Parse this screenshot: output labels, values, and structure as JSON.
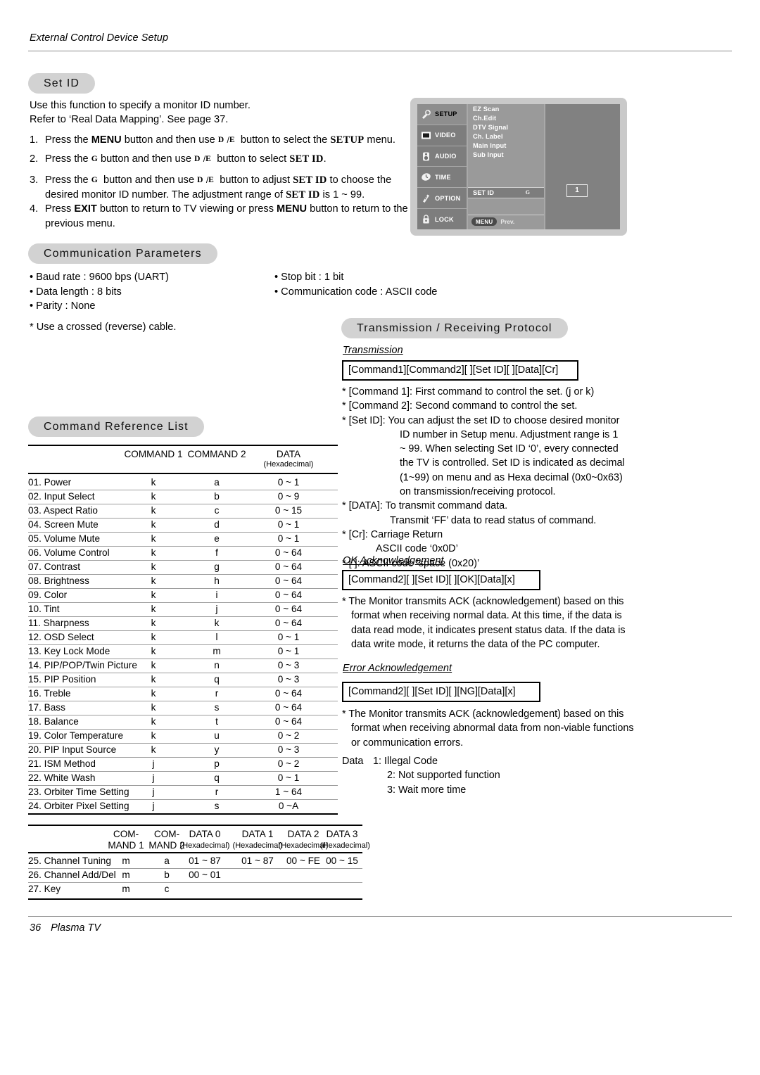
{
  "header": {
    "running_head": "External Control Device Setup"
  },
  "footer": {
    "page_number": "36",
    "product": "Plasma TV"
  },
  "set_id": {
    "title": "Set ID",
    "intro_line1": "Use this function to specify a monitor ID number.",
    "intro_line2": "Refer to ‘Real Data Mapping’. See page 37.",
    "steps": [
      {
        "num": "1.",
        "parts": [
          "Press the ",
          "MENU",
          " button and then use ",
          "D",
          "/",
          "E",
          " button to select the ",
          "SETUP",
          " menu."
        ]
      },
      {
        "num": "2.",
        "parts": [
          "Press the ",
          "G",
          " button and then use ",
          "D",
          "/",
          "E",
          " button to select ",
          "SET ID",
          "."
        ]
      },
      {
        "num": "3.",
        "parts": [
          "Press the ",
          "G",
          " button and then use ",
          "D",
          "/",
          "E",
          " button to adjust ",
          "SET ID",
          " to choose the desired monitor ID number. The adjustment range of ",
          "SET ID",
          " is 1 ~ 99."
        ]
      },
      {
        "num": "4.",
        "parts": [
          "Press ",
          "EXIT",
          " button to return to TV viewing or press ",
          "MENU",
          " button to return to the previous menu."
        ]
      }
    ]
  },
  "osd": {
    "categories": [
      {
        "label": "SETUP",
        "icon": "satellite-icon",
        "selected": true
      },
      {
        "label": "VIDEO",
        "icon": "screen-icon",
        "selected": false
      },
      {
        "label": "AUDIO",
        "icon": "speaker-icon",
        "selected": false
      },
      {
        "label": "TIME",
        "icon": "clock-icon",
        "selected": false
      },
      {
        "label": "OPTION",
        "icon": "remote-icon",
        "selected": false
      },
      {
        "label": "LOCK",
        "icon": "padlock-icon",
        "selected": false
      }
    ],
    "menu_items": [
      "EZ Scan",
      "Ch.Edit",
      "DTV Signal",
      "Ch. Label",
      "Main Input",
      "Sub Input"
    ],
    "highlighted_item": "SET ID",
    "highlighted_arrow": "G",
    "value": "1",
    "menu_button": "MENU",
    "prev_label": "Prev."
  },
  "communication": {
    "title": "Communication Parameters",
    "left": [
      "• Baud rate : 9600 bps (UART)",
      "• Data length : 8 bits",
      "• Parity : None"
    ],
    "right": [
      "• Stop bit : 1 bit",
      "• Communication code : ASCII code"
    ],
    "note": "* Use a crossed (reverse) cable."
  },
  "command_reference": {
    "title": "Command Reference List",
    "headers": [
      "",
      "COMMAND 1",
      "COMMAND 2",
      "DATA"
    ],
    "data_sub": "(Hexadecimal)",
    "rows": [
      {
        "name": "01. Power",
        "c1": "k",
        "c2": "a",
        "data": "0 ~ 1"
      },
      {
        "name": "02. Input Select",
        "c1": "k",
        "c2": "b",
        "data": "0 ~ 9"
      },
      {
        "name": "03. Aspect Ratio",
        "c1": "k",
        "c2": "c",
        "data": "0 ~ 15"
      },
      {
        "name": "04. Screen Mute",
        "c1": "k",
        "c2": "d",
        "data": "0 ~ 1"
      },
      {
        "name": "05. Volume Mute",
        "c1": "k",
        "c2": "e",
        "data": "0 ~ 1"
      },
      {
        "name": "06. Volume Control",
        "c1": "k",
        "c2": "f",
        "data": "0 ~ 64"
      },
      {
        "name": "07. Contrast",
        "c1": "k",
        "c2": "g",
        "data": "0 ~ 64"
      },
      {
        "name": "08. Brightness",
        "c1": "k",
        "c2": "h",
        "data": "0 ~ 64"
      },
      {
        "name": "09. Color",
        "c1": "k",
        "c2": "i",
        "data": "0 ~ 64"
      },
      {
        "name": "10. Tint",
        "c1": "k",
        "c2": "j",
        "data": "0 ~ 64"
      },
      {
        "name": "11. Sharpness",
        "c1": "k",
        "c2": "k",
        "data": "0 ~ 64"
      },
      {
        "name": "12. OSD Select",
        "c1": "k",
        "c2": "l",
        "data": "0 ~ 1"
      },
      {
        "name": "13. Key Lock Mode",
        "c1": "k",
        "c2": "m",
        "data": "0 ~ 1"
      },
      {
        "name": "14. PIP/POP/Twin Picture",
        "c1": "k",
        "c2": "n",
        "data": "0 ~ 3"
      },
      {
        "name": "15. PIP Position",
        "c1": "k",
        "c2": "q",
        "data": "0 ~ 3"
      },
      {
        "name": "16. Treble",
        "c1": "k",
        "c2": "r",
        "data": "0 ~ 64"
      },
      {
        "name": "17. Bass",
        "c1": "k",
        "c2": "s",
        "data": "0 ~ 64"
      },
      {
        "name": "18. Balance",
        "c1": "k",
        "c2": "t",
        "data": "0 ~ 64"
      },
      {
        "name": "19. Color Temperature",
        "c1": "k",
        "c2": "u",
        "data": "0 ~ 2"
      },
      {
        "name": "20. PIP Input Source",
        "c1": "k",
        "c2": "y",
        "data": "0 ~ 3"
      },
      {
        "name": "21. ISM Method",
        "c1": "j",
        "c2": "p",
        "data": "0 ~ 2"
      },
      {
        "name": "22. White Wash",
        "c1": "j",
        "c2": "q",
        "data": "0 ~ 1"
      },
      {
        "name": "23. Orbiter Time Setting",
        "c1": "j",
        "c2": "r",
        "data": "1 ~ 64"
      },
      {
        "name": "24. Orbiter Pixel Setting",
        "c1": "j",
        "c2": "s",
        "data": "0 ~A"
      }
    ]
  },
  "channel_table": {
    "headers": [
      {
        "l1": "COM-",
        "l2": "MAND 1",
        "sub": ""
      },
      {
        "l1": "COM-",
        "l2": "MAND 2",
        "sub": ""
      },
      {
        "l1": "DATA 0",
        "l2": "",
        "sub": "(Hexadecimal)"
      },
      {
        "l1": "DATA 1",
        "l2": "",
        "sub": "(Hexadecimal)"
      },
      {
        "l1": "DATA 2",
        "l2": "",
        "sub": "(Hexadecimal)"
      },
      {
        "l1": "DATA 3",
        "l2": "",
        "sub": "(Hexadecimal)"
      }
    ],
    "rows": [
      {
        "name": "25. Channel Tuning",
        "c1": "m",
        "c2": "a",
        "d0": "01 ~ 87",
        "d1": "01 ~ 87",
        "d2": "00 ~ FE",
        "d3": "00 ~ 15"
      },
      {
        "name": "26. Channel Add/Del",
        "c1": "m",
        "c2": "b",
        "d0": "00 ~ 01",
        "d1": "",
        "d2": "",
        "d3": ""
      },
      {
        "name": "27. Key",
        "c1": "m",
        "c2": "c",
        "d0": "",
        "d1": "",
        "d2": "",
        "d3": ""
      }
    ]
  },
  "protocol": {
    "title": "Transmission / Receiving  Protocol",
    "transmission_label": "Transmission",
    "transmission_format": "[Command1][Command2][  ][Set ID][  ][Data][Cr]",
    "notes": [
      "* [Command 1]: First command to control the set. (j or k)",
      "* [Command 2]: Second command to control the set.",
      "* [Set ID]: You can adjust the set ID to choose desired monitor",
      "ID number in Setup menu. Adjustment range is 1",
      "~ 99. When selecting Set ID ‘0’, every connected",
      "the TV is controlled. Set ID is indicated as decimal",
      "(1~99) on menu and as Hexa decimal (0x0~0x63)",
      "on transmission/receiving protocol.",
      "* [DATA]: To transmit command data.",
      "Transmit ‘FF’ data to read status of command.",
      "* [Cr]: Carriage Return",
      "ASCII code ‘0x0D’",
      "* [   ]: ASCII code ‘space (0x20)’"
    ],
    "ok_label": "OK Acknowledgement",
    "ok_format": "[Command2][  ][Set ID][  ][OK][Data][x]",
    "ok_note": "* The Monitor transmits ACK (acknowledgement) based on this format when receiving normal data. At this time, if the data is data read mode, it indicates present status data. If the data is data write mode, it returns the data of the PC computer.",
    "err_label": "Error Acknowledgement",
    "err_format": "[Command2][  ][Set ID][  ][NG][Data][x]",
    "err_note": "* The Monitor transmits ACK (acknowledgement) based on this format when receiving abnormal data from non-viable functions or communication errors.",
    "data_label": "Data",
    "data_codes": [
      "1: Illegal Code",
      "2: Not supported function",
      "3: Wait more time"
    ]
  }
}
